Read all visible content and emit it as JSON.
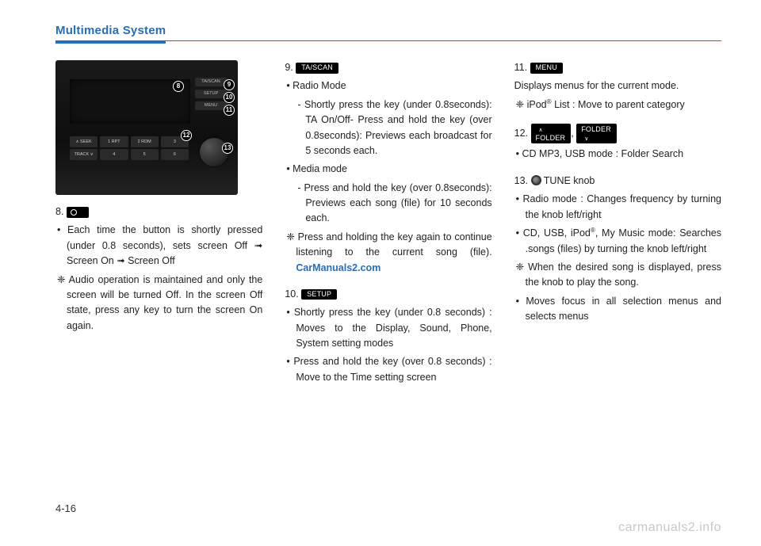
{
  "header": {
    "title": "Multimedia System"
  },
  "page_number": "4-16",
  "watermark": "carmanuals2.info",
  "link_text": "CarManuals2.com",
  "items": {
    "i8": {
      "num": "8.",
      "bullet1": "Each time the button is shortly pressed (under 0.8 seconds), sets screen Off ➟ Screen On ➟ Screen Off",
      "note1": "❈ Audio operation is maintained and only the screen will be turned Off. In the screen Off state, press any key to turn the screen On again."
    },
    "i9": {
      "num": "9.",
      "label": "TA/SCAN",
      "line1": "• Radio Mode",
      "sub1": "- Shortly press the key (under 0.8seconds): TA On/Off- Press and hold the key (over 0.8seconds): Previews each broadcast for 5 seconds each.",
      "line2": "• Media mode",
      "sub2": "- Press and hold the key (over 0.8seconds): Previews each song (file) for 10 seconds each.",
      "note1_a": "❈ Press and holding the key again to continue listening to the current song (file).   ",
      "note1_b": ""
    },
    "i10": {
      "num": "10.",
      "label": "SETUP",
      "bullet1": "Shortly press the key (under 0.8 seconds) : Moves to the Display, Sound, Phone, System setting modes",
      "bullet2": "Press and hold the key (over 0.8 seconds) : Move to the Time setting screen"
    },
    "i11": {
      "num": "11.",
      "label": "MENU",
      "line1": "Displays menus for the current mode.",
      "note1": "❈ iPod® List : Move to parent category"
    },
    "i12": {
      "num": "12.",
      "label1": "FOLDER",
      "label2": "FOLDER",
      "bullet1": "CD MP3, USB mode : Folder Search"
    },
    "i13": {
      "num": "13.",
      "knob_label": " TUNE knob",
      "bullet1": "Radio mode : Changes frequency by turning the knob left/right",
      "bullet2": "CD, USB, iPod®, My Music mode: Searches .songs (files) by turning the knob left/right",
      "note1": "❈ When the desired song is displayed, press the knob to play the song.",
      "bullet3": "Moves focus in all selection menus and selects menus"
    }
  },
  "radio_btns": {
    "side1": "TA/SCAN",
    "side2": "SETUP",
    "side3": "MENU",
    "r1": [
      "∧ SEEK",
      "1 RPT",
      "2 RDM",
      "3"
    ],
    "r2": [
      "TRACK ∨",
      "4",
      "5",
      "6"
    ],
    "folder": "∧ FOLDER ∨"
  }
}
